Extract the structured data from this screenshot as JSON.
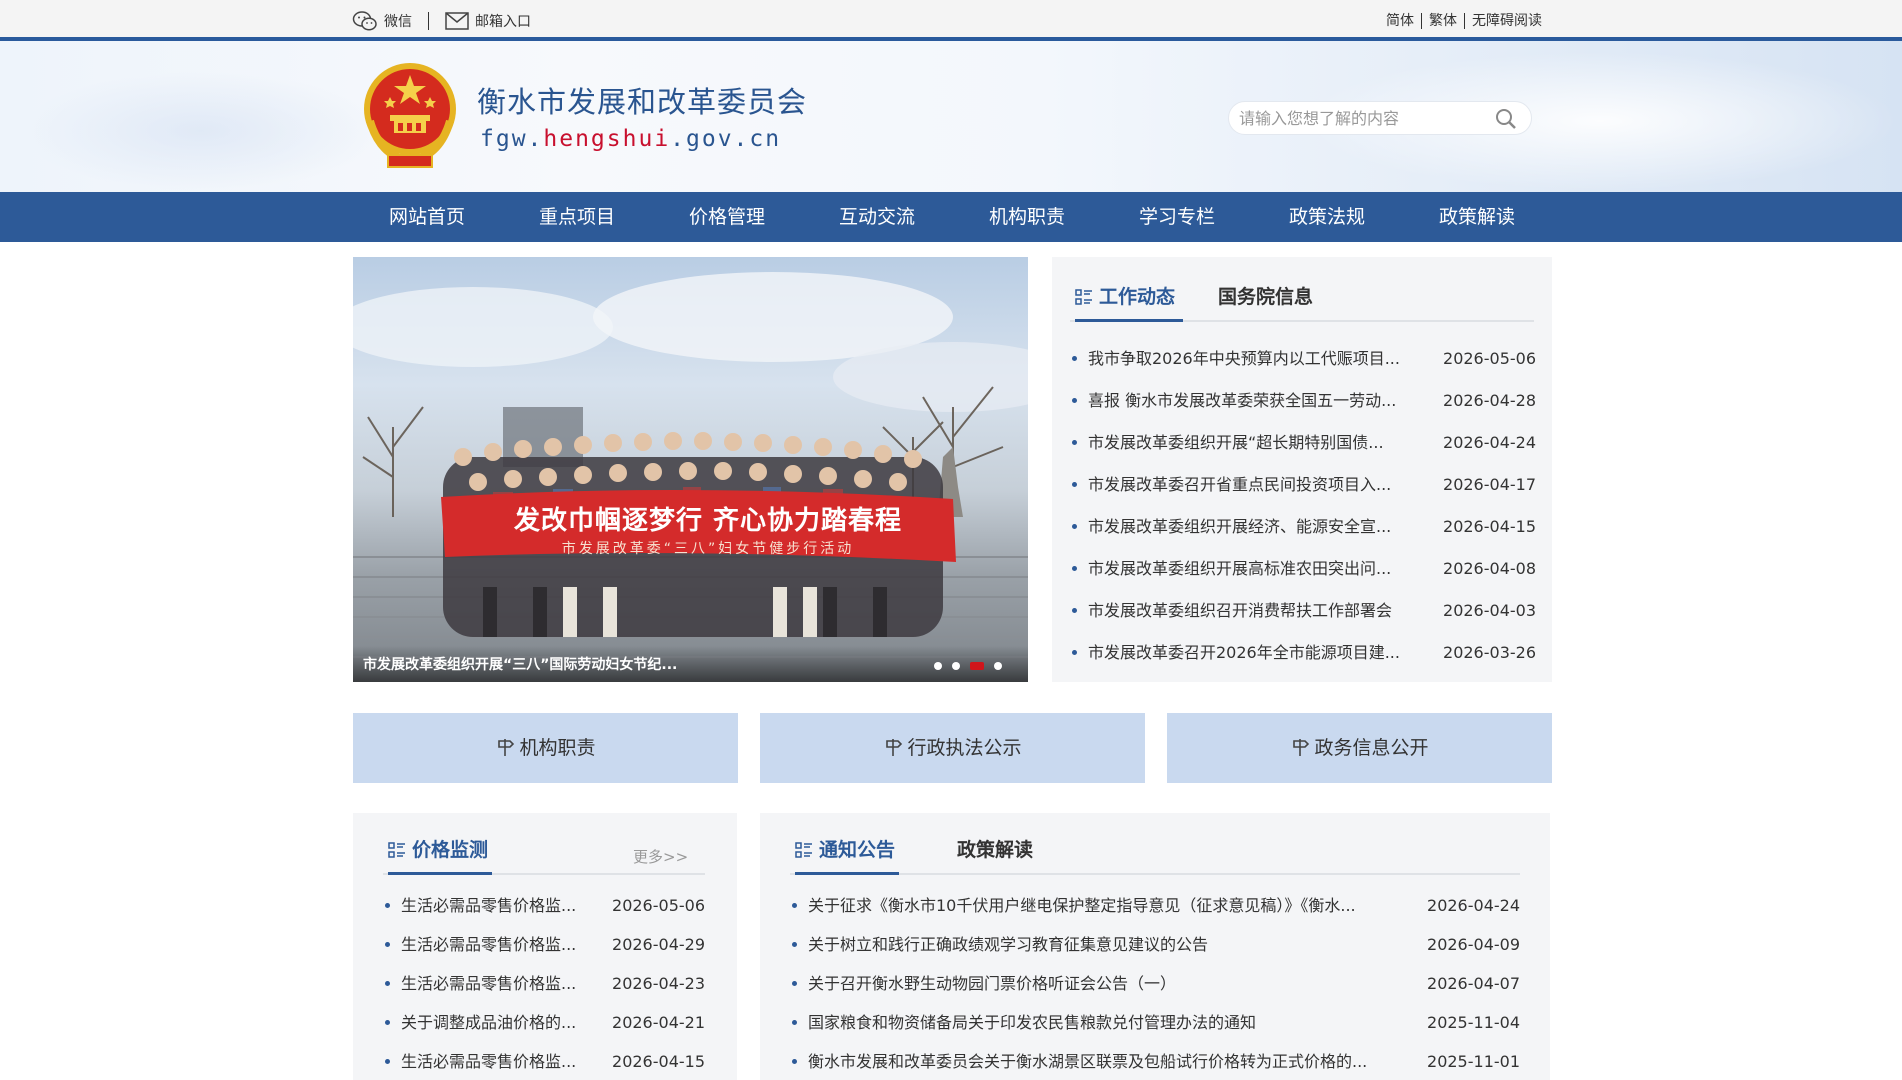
{
  "topbar": {
    "wechat": "微信",
    "mail": "邮箱入口",
    "simplified": "简体",
    "traditional": "繁体",
    "accessible": "无障碍阅读"
  },
  "header": {
    "title": "衡水市发展和改革委员会",
    "url_prefix": "fgw.",
    "url_domain": "hengshui",
    "url_suffix": ".gov.cn",
    "search_placeholder": "请输入您想了解的内容"
  },
  "nav": [
    {
      "label": "网站首页"
    },
    {
      "label": "重点项目"
    },
    {
      "label": "价格管理"
    },
    {
      "label": "互动交流"
    },
    {
      "label": "机构职责"
    },
    {
      "label": "学习专栏"
    },
    {
      "label": "政策法规"
    },
    {
      "label": "政策解读"
    }
  ],
  "carousel": {
    "banner_line1": "发改巾帼逐梦行 齐心协力踏春程",
    "banner_line2": "市发展改革委“三八”妇女节健步行活动",
    "caption": "市发展改革委组织开展“三八”国际劳动妇女节纪...",
    "slide_count": 4,
    "active_slide": 3
  },
  "news": {
    "tabs": [
      {
        "label": "工作动态",
        "active": true
      },
      {
        "label": "国务院信息",
        "active": false
      }
    ],
    "items": [
      {
        "title": "我市争取2026年中央预算内以工代赈项目...",
        "date": "2026-05-06"
      },
      {
        "title": "喜报 衡水市发展改革委荣获全国五一劳动...",
        "date": "2026-04-28"
      },
      {
        "title": "市发展改革委组织开展“超长期特别国债...",
        "date": "2026-04-24"
      },
      {
        "title": "市发展改革委召开省重点民间投资项目入...",
        "date": "2026-04-17"
      },
      {
        "title": "市发展改革委组织开展经济、能源安全宣...",
        "date": "2026-04-15"
      },
      {
        "title": "市发展改革委组织开展高标准农田突出问...",
        "date": "2026-04-08"
      },
      {
        "title": "市发展改革委组织召开消费帮扶工作部署会",
        "date": "2026-04-03"
      },
      {
        "title": "市发展改革委召开2026年全市能源项目建...",
        "date": "2026-03-26"
      }
    ]
  },
  "quick": [
    {
      "label": "机构职责"
    },
    {
      "label": "行政执法公示"
    },
    {
      "label": "政务信息公开"
    }
  ],
  "price": {
    "tab": "价格监测",
    "more": "更多>>",
    "items": [
      {
        "title": "生活必需品零售价格监...",
        "date": "2026-05-06"
      },
      {
        "title": "生活必需品零售价格监...",
        "date": "2026-04-29"
      },
      {
        "title": "生活必需品零售价格监...",
        "date": "2026-04-23"
      },
      {
        "title": "关于调整成品油价格的...",
        "date": "2026-04-21"
      },
      {
        "title": "生活必需品零售价格监...",
        "date": "2026-04-15"
      }
    ]
  },
  "notice": {
    "tabs": [
      {
        "label": "通知公告",
        "active": true
      },
      {
        "label": "政策解读",
        "active": false
      }
    ],
    "items": [
      {
        "title": "关于征求《衡水市10千伏用户继电保护整定指导意见（征求意见稿）》《衡水...",
        "date": "2026-04-24"
      },
      {
        "title": "关于树立和践行正确政绩观学习教育征集意见建议的公告",
        "date": "2026-04-09"
      },
      {
        "title": "关于召开衡水野生动物园门票价格听证会公告（一）",
        "date": "2026-04-07"
      },
      {
        "title": "国家粮食和物资储备局关于印发农民售粮款兑付管理办法的通知",
        "date": "2025-11-04"
      },
      {
        "title": "衡水市发展和改革委员会关于衡水湖景区联票及包船试行价格转为正式价格的...",
        "date": "2025-11-01"
      }
    ]
  },
  "colors": {
    "primary": "#2d5a98",
    "accent_red": "#c8102e",
    "quick_bg": "#c9d9ef",
    "panel_bg": "#f4f5f7"
  }
}
